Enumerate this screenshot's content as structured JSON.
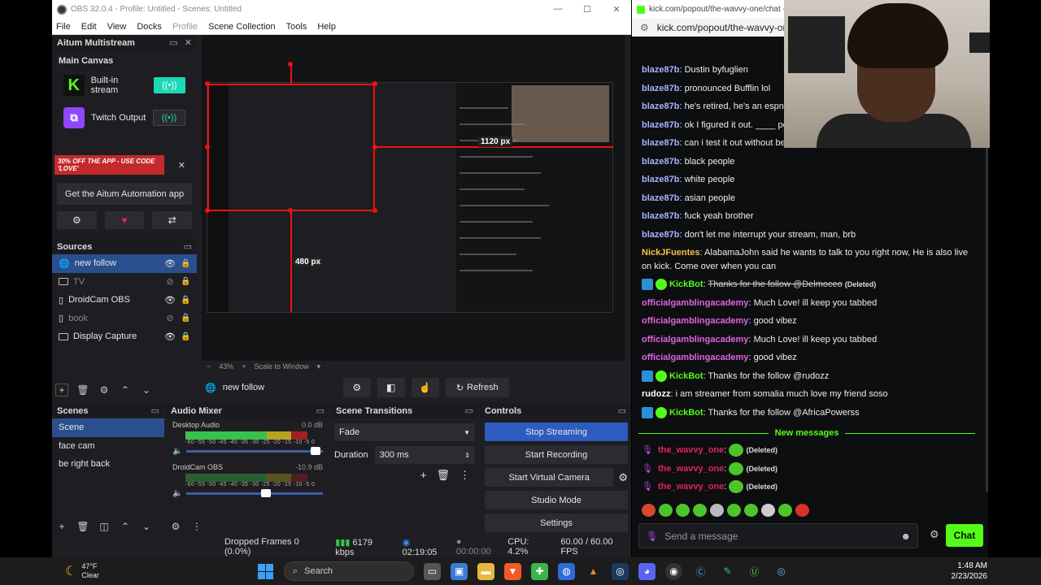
{
  "obs": {
    "title": "OBS 32.0.4 - Profile: Untitled - Scenes: Untitled",
    "menu": [
      "File",
      "Edit",
      "View",
      "Docks",
      "Profile",
      "Scene Collection",
      "Tools",
      "Help"
    ],
    "aitum": {
      "title": "Aitum Multistream",
      "canvas_label": "Main Canvas",
      "outputs": [
        {
          "label": "Built-in stream",
          "active": true
        },
        {
          "label": "Twitch Output",
          "active": false
        }
      ],
      "promo": "30% OFF THE APP - USE CODE 'LOVE'",
      "app_button": "Get the Aitum Automation app"
    },
    "sources": {
      "title": "Sources",
      "items": [
        {
          "name": "new follow",
          "visible": true,
          "selected": true,
          "icon": "browser-icon"
        },
        {
          "name": "TV",
          "visible": false,
          "selected": false,
          "icon": "monitor-icon"
        },
        {
          "name": "DroidCam OBS",
          "visible": true,
          "selected": false,
          "icon": "camera-icon"
        },
        {
          "name": "book",
          "visible": false,
          "selected": false,
          "icon": "document-icon"
        },
        {
          "name": "Display Capture",
          "visible": true,
          "selected": false,
          "icon": "monitor-icon"
        }
      ]
    },
    "preview": {
      "label_width": "1120 px",
      "label_height": "480 px",
      "zoom": "43%",
      "zoom_mode": "Scale to Window"
    },
    "source_bar": {
      "selected": "new follow",
      "refresh": "Refresh"
    },
    "scenes": {
      "title": "Scenes",
      "items": [
        "Scene",
        "face cam",
        "be right back"
      ]
    },
    "mixer": {
      "title": "Audio Mixer",
      "tracks": [
        {
          "name": "Desktop Audio",
          "db": "0.0 dB",
          "volume": 0.98
        },
        {
          "name": "DroidCam OBS",
          "db": "-10.9 dB",
          "volume": 0.62
        }
      ],
      "scale": "-60 -55 -50 -45 -40 -35 -30 -25 -20 -15 -10 -5 0"
    },
    "transitions": {
      "title": "Scene Transitions",
      "selected": "Fade",
      "duration_label": "Duration",
      "duration": "300 ms"
    },
    "controls": {
      "title": "Controls",
      "buttons": [
        "Stop Streaming",
        "Start Recording",
        "Start Virtual Camera",
        "Studio Mode",
        "Settings"
      ]
    },
    "status": {
      "dropped": "Dropped Frames 0 (0.0%)",
      "bitrate": "6179 kbps",
      "stream_time": "02:19:05",
      "rec_time": "00:00:00",
      "cpu": "CPU: 4.2%",
      "fps": "60.00 / 60.00 FPS"
    }
  },
  "chat": {
    "title": "kick.com/popout/the-wavvy-one/chat - Br",
    "url": "kick.com/popout/the-wavvy-one/c",
    "messages": [
      {
        "user": "blaze87b",
        "color": "#a6b2ff",
        "text": "Dustin byfuglien"
      },
      {
        "user": "blaze87b",
        "color": "#a6b2ff",
        "text": "pronounced Bufflin lol"
      },
      {
        "user": "blaze87b",
        "color": "#a6b2ff",
        "text": "he's retired, he's an espn a"
      },
      {
        "user": "blaze87b",
        "color": "#a6b2ff",
        "text": "ok I figured it out. ____ peo"
      },
      {
        "user": "blaze87b",
        "color": "#a6b2ff",
        "text": "can i test it out without bein"
      },
      {
        "user": "blaze87b",
        "color": "#a6b2ff",
        "text": "black people"
      },
      {
        "user": "blaze87b",
        "color": "#a6b2ff",
        "text": "white people"
      },
      {
        "user": "blaze87b",
        "color": "#a6b2ff",
        "text": "asian people"
      },
      {
        "user": "blaze87b",
        "color": "#a6b2ff",
        "text": "fuck yeah brother"
      },
      {
        "user": "blaze87b",
        "color": "#a6b2ff",
        "text": "don't let me interrupt your stream, man, brb"
      },
      {
        "user": "NickJFuentes",
        "color": "#f5c24a",
        "text": "AlabamaJohn said he wants to talk to you right now, He is also live on kick. Come over when you can"
      },
      {
        "user": "KickBot",
        "color": "#53fc18",
        "text": "Thanks for the follow @Delmoceo",
        "deleted": "(Deleted)",
        "bot": true
      },
      {
        "user": "officialgamblingacademy",
        "color": "#e064e0",
        "text": "Much Love! ill keep you tabbed"
      },
      {
        "user": "officialgamblingacademy",
        "color": "#e064e0",
        "text": "good vibez"
      },
      {
        "user": "officialgamblingacademy",
        "color": "#e064e0",
        "text": "Much Love! ill keep you tabbed"
      },
      {
        "user": "officialgamblingacademy",
        "color": "#e064e0",
        "text": "good vibez"
      },
      {
        "user": "KickBot",
        "color": "#53fc18",
        "text": "Thanks for the follow @rudozz",
        "bot": true
      },
      {
        "user": "rudozz",
        "color": "#ffffff",
        "text": "i am streamer from somalia much love my friend soso"
      },
      {
        "user": "KickBot",
        "color": "#53fc18",
        "text": "Thanks for the follow @AfricaPowerss",
        "bot": true
      }
    ],
    "new_messages_label": "New messages",
    "new_messages": [
      {
        "user": "the_wavvy_one",
        "deleted": "(Deleted)"
      },
      {
        "user": "the_wavvy_one",
        "deleted": "(Deleted)"
      },
      {
        "user": "the_wavvy_one",
        "deleted": "(Deleted)"
      }
    ],
    "input_placeholder": "Send a message",
    "send_label": "Chat"
  },
  "taskbar": {
    "temp": "47°F",
    "condition": "Clear",
    "search": "Search",
    "time": "1:48 AM",
    "date": "2/23/2026"
  }
}
